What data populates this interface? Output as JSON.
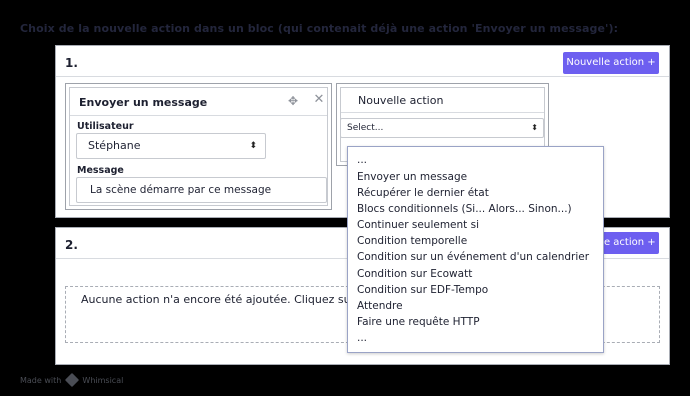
{
  "heading": "Choix de la nouvelle action dans un bloc (qui contenait déjà une action 'Envoyer un message'):",
  "block1": {
    "number": "1.",
    "new_action_button": "Nouvelle action +",
    "action_card": {
      "title": "Envoyer un message",
      "user_label": "Utilisateur",
      "user_value": "Stéphane",
      "message_label": "Message",
      "message_value": "La scène démarre par ce message"
    },
    "new_action_card": {
      "title": "Nouvelle action",
      "select_value": "Select..."
    }
  },
  "block2": {
    "number": "2.",
    "new_action_button": "Nouvelle action +",
    "empty_text": "Aucune action n'a encore été ajoutée. Cliquez sur le bouton « Nouvelle action + »"
  },
  "dropdown": {
    "options": [
      "...",
      "Envoyer un message",
      "Récupérer le dernier état",
      "Blocs conditionnels (Si... Alors... Sinon...)",
      "Continuer seulement si",
      "Condition temporelle",
      "Condition sur un événement d'un calendrier",
      "Condition sur Ecowatt",
      "Condition sur EDF-Tempo",
      "Attendre",
      "Faire une requête HTTP",
      "..."
    ]
  },
  "footer": {
    "made_with": "Made with",
    "brand": "Whimsical"
  },
  "icons": {
    "move": "move-icon",
    "close": "close-icon",
    "select_caret": "chevron-updown-icon"
  },
  "colors": {
    "accent": "#6d5ff0",
    "background": "#000000"
  }
}
